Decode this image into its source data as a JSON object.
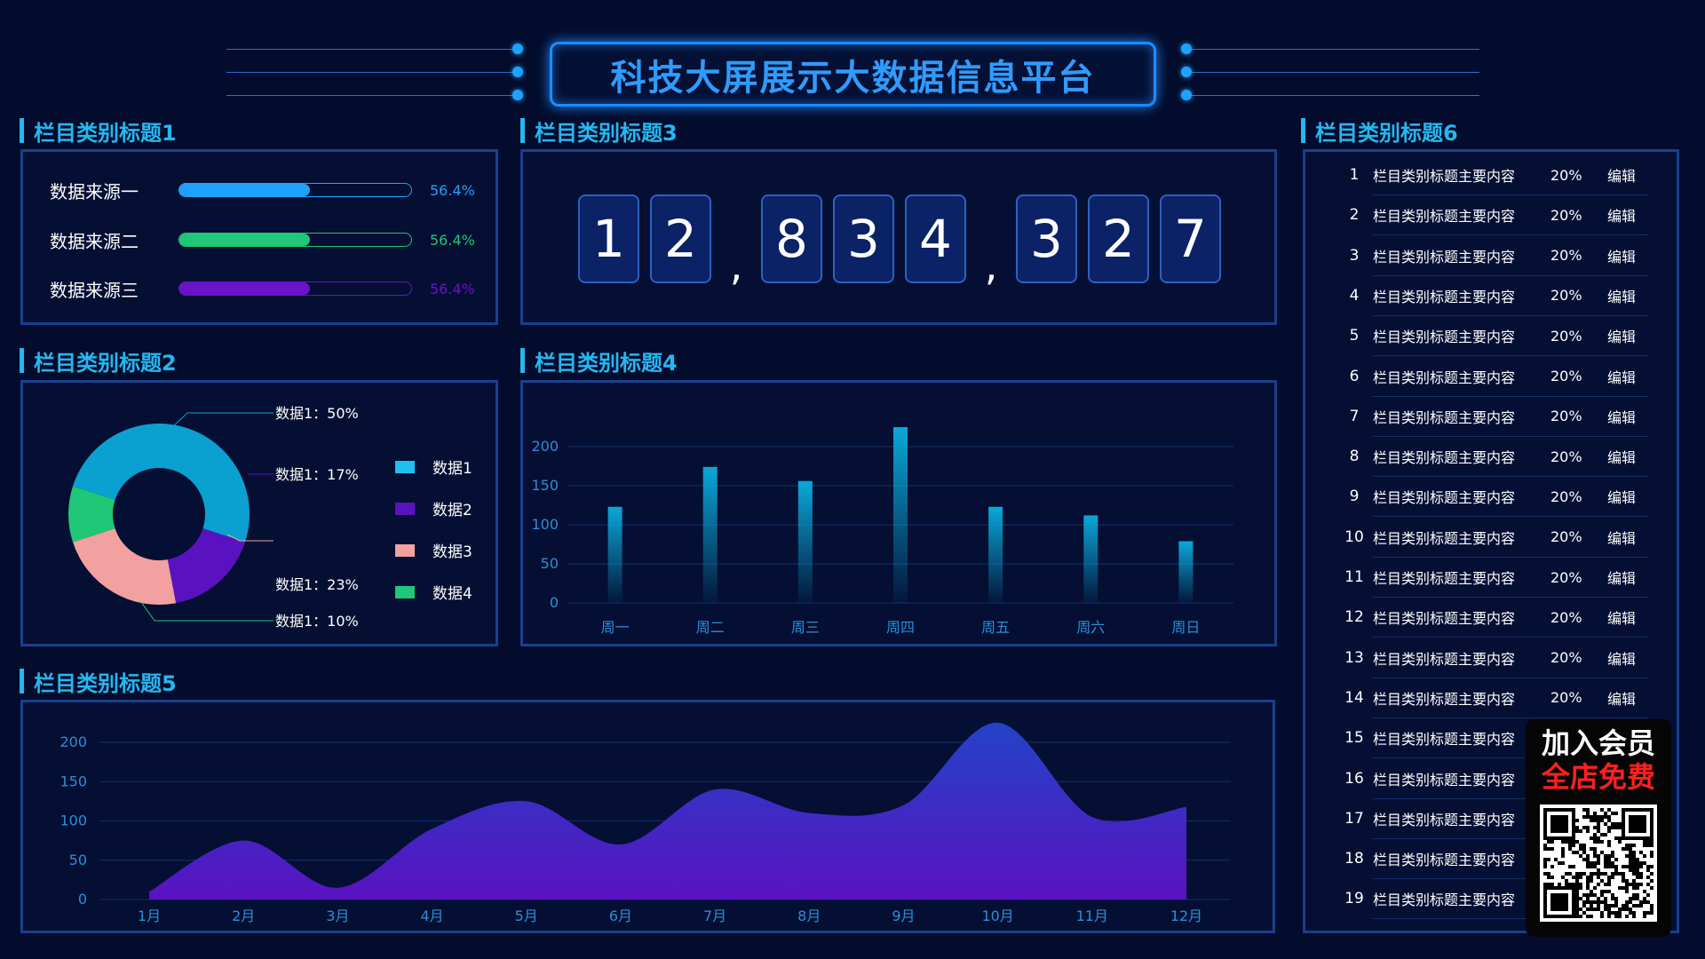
{
  "header": {
    "title": "科技大屏展示大数据信息平台"
  },
  "sections": {
    "s1": "栏目类别标题1",
    "s2": "栏目类别标题2",
    "s3": "栏目类别标题3",
    "s4": "栏目类别标题4",
    "s5": "栏目类别标题5",
    "s6": "栏目类别标题6"
  },
  "panel1": {
    "rows": [
      {
        "label": "数据来源一",
        "percent_text": "56.4%",
        "value": 0.564,
        "color": "#1fa2ff"
      },
      {
        "label": "数据来源二",
        "percent_text": "56.4%",
        "value": 0.564,
        "color": "#1fc777"
      },
      {
        "label": "数据来源三",
        "percent_text": "56.4%",
        "value": 0.564,
        "color": "#6a13c8"
      }
    ]
  },
  "panel3": {
    "digits": [
      "1",
      "2",
      "8",
      "3",
      "4",
      "3",
      "2",
      "7"
    ],
    "separator": ","
  },
  "panel2": {
    "labels": [
      "数据1：50%",
      "数据1：17%",
      "数据1：23%",
      "数据1：10%"
    ],
    "legend": [
      "数据1",
      "数据2",
      "数据3",
      "数据4"
    ]
  },
  "panel6": {
    "rows": [
      {
        "num": "1",
        "content": "栏目类别标题主要内容",
        "pct": "20%",
        "action": "编辑"
      },
      {
        "num": "2",
        "content": "栏目类别标题主要内容",
        "pct": "20%",
        "action": "编辑"
      },
      {
        "num": "3",
        "content": "栏目类别标题主要内容",
        "pct": "20%",
        "action": "编辑"
      },
      {
        "num": "4",
        "content": "栏目类别标题主要内容",
        "pct": "20%",
        "action": "编辑"
      },
      {
        "num": "5",
        "content": "栏目类别标题主要内容",
        "pct": "20%",
        "action": "编辑"
      },
      {
        "num": "6",
        "content": "栏目类别标题主要内容",
        "pct": "20%",
        "action": "编辑"
      },
      {
        "num": "7",
        "content": "栏目类别标题主要内容",
        "pct": "20%",
        "action": "编辑"
      },
      {
        "num": "8",
        "content": "栏目类别标题主要内容",
        "pct": "20%",
        "action": "编辑"
      },
      {
        "num": "9",
        "content": "栏目类别标题主要内容",
        "pct": "20%",
        "action": "编辑"
      },
      {
        "num": "10",
        "content": "栏目类别标题主要内容",
        "pct": "20%",
        "action": "编辑"
      },
      {
        "num": "11",
        "content": "栏目类别标题主要内容",
        "pct": "20%",
        "action": "编辑"
      },
      {
        "num": "12",
        "content": "栏目类别标题主要内容",
        "pct": "20%",
        "action": "编辑"
      },
      {
        "num": "13",
        "content": "栏目类别标题主要内容",
        "pct": "20%",
        "action": "编辑"
      },
      {
        "num": "14",
        "content": "栏目类别标题主要内容",
        "pct": "20%",
        "action": "编辑"
      },
      {
        "num": "15",
        "content": "栏目类别标题主要内容",
        "pct": "",
        "action": ""
      },
      {
        "num": "16",
        "content": "栏目类别标题主要内容",
        "pct": "",
        "action": ""
      },
      {
        "num": "17",
        "content": "栏目类别标题主要内容",
        "pct": "",
        "action": ""
      },
      {
        "num": "18",
        "content": "栏目类别标题主要内容",
        "pct": "",
        "action": ""
      },
      {
        "num": "19",
        "content": "栏目类别标题主要内容",
        "pct": "",
        "action": ""
      }
    ]
  },
  "promo": {
    "line1": "加入会员",
    "line2": "全店免费"
  },
  "chart_data": [
    {
      "type": "pie",
      "labels": [
        "数据1",
        "数据2",
        "数据3",
        "数据4"
      ],
      "values": [
        50,
        17,
        23,
        10
      ],
      "colors": [
        "#0aa0d0",
        "#5a12c0",
        "#f2a0a0",
        "#1fc777"
      ],
      "donut": true
    },
    {
      "type": "bar",
      "categories": [
        "周一",
        "周二",
        "周三",
        "周四",
        "周五",
        "周六",
        "周日"
      ],
      "values": [
        123,
        174,
        156,
        225,
        123,
        112,
        79
      ],
      "ylim": [
        0,
        200
      ],
      "yticks": [
        0,
        50,
        100,
        150,
        200
      ],
      "grid": true,
      "color": "#0aa0d0"
    },
    {
      "type": "area",
      "categories": [
        "1月",
        "2月",
        "3月",
        "4月",
        "5月",
        "6月",
        "7月",
        "8月",
        "9月",
        "10月",
        "11月",
        "12月"
      ],
      "values": [
        10,
        75,
        15,
        90,
        125,
        70,
        140,
        110,
        120,
        225,
        105,
        118
      ],
      "ylim": [
        0,
        200
      ],
      "yticks": [
        0,
        50,
        100,
        150,
        200
      ],
      "grid": true,
      "color_top": "#2343c8",
      "color_bottom": "#5a12c0"
    }
  ]
}
